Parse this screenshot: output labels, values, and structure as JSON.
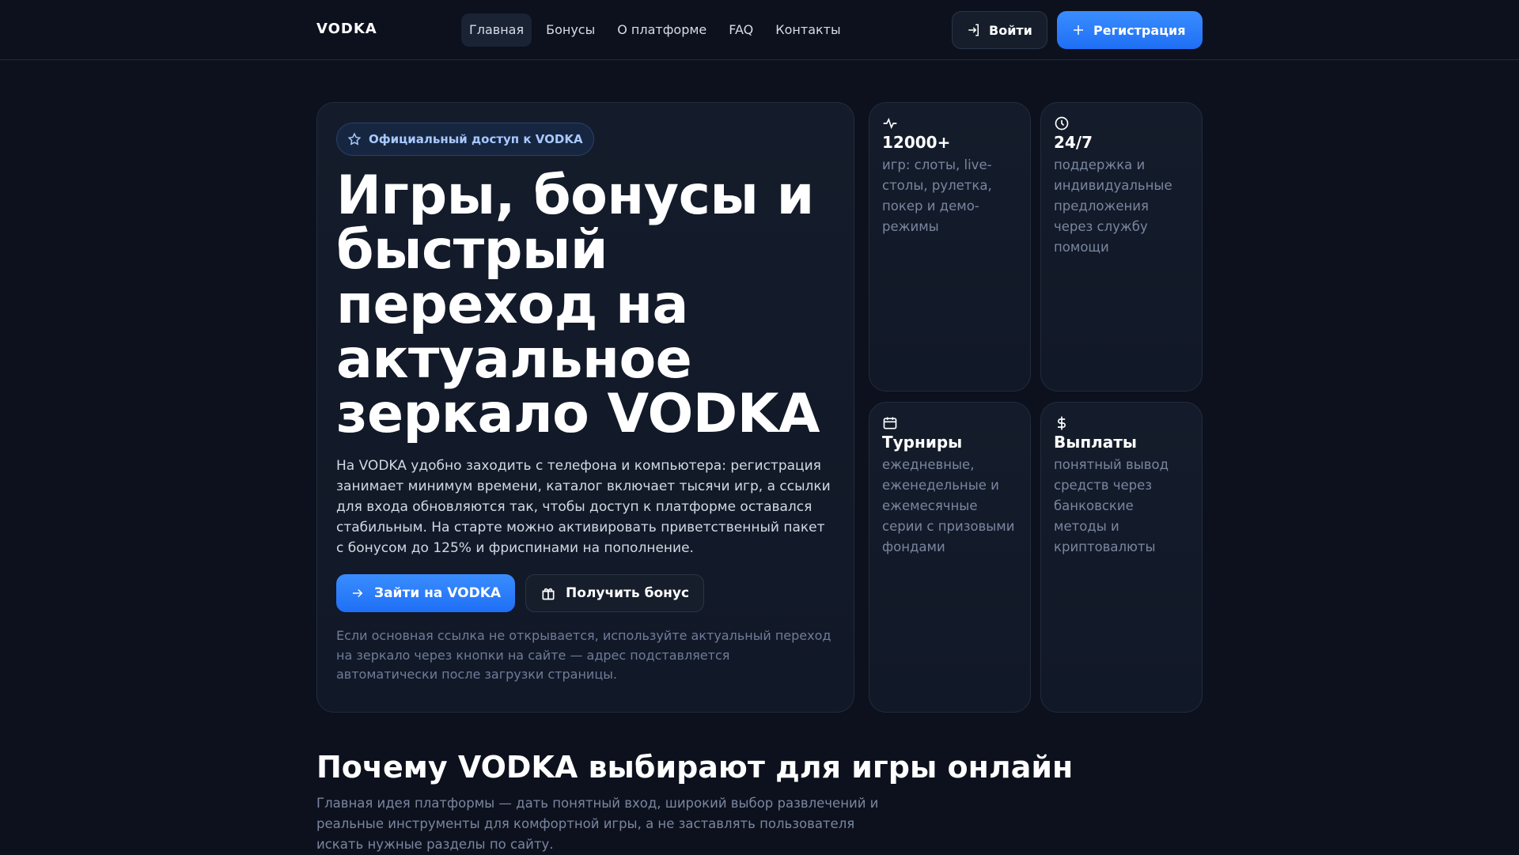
{
  "header": {
    "logo": "VODKA",
    "nav": [
      "Главная",
      "Бонусы",
      "О платформе",
      "FAQ",
      "Контакты"
    ],
    "login": "Войти",
    "register": "Регистрация"
  },
  "hero": {
    "badge": "Официальный доступ к VODKA",
    "title": "Игры, бонусы и быстрый переход на актуальное зеркало VODKA",
    "lead": "На VODKA удобно заходить с телефона и компьютера: регистрация занимает минимум времени, каталог включает тысячи игр, а ссылки для входа обновляются так, чтобы доступ к платформе оставался стабильным. На старте можно активировать приветственный пакет с бонусом до 125% и фриспинами на пополнение.",
    "cta_primary": "Зайти на VODKA",
    "cta_secondary": "Получить бонус",
    "note": "Если основная ссылка не открывается, используйте актуальный переход на зеркало через кнопки на сайте — адрес подставляется автоматически после загрузки страницы."
  },
  "stats": [
    {
      "icon": "activity-icon",
      "title": "12000+",
      "desc": "игр: слоты, live-столы, рулетка, покер и демо-режимы"
    },
    {
      "icon": "clock-icon",
      "title": "24/7",
      "desc": "поддержка и индивидуальные предложения через службу помощи"
    },
    {
      "icon": "calendar-icon",
      "title": "Турниры",
      "desc": "ежедневные, еженедельные и ежемесячные серии с призовыми фондами"
    },
    {
      "icon": "dollar-icon",
      "title": "Выплаты",
      "desc": "понятный вывод средств через банковские методы и криптовалюты"
    }
  ],
  "why": {
    "title": "Почему VODKA выбирают для игры онлайн",
    "text": "Главная идея платформы — дать понятный вход, широкий выбор развлечений и реальные инструменты для комфортной игры, а не заставлять пользователя искать нужные разделы по сайту."
  },
  "colors": {
    "accent": "#2f7fff",
    "bg": "#0c111d"
  }
}
